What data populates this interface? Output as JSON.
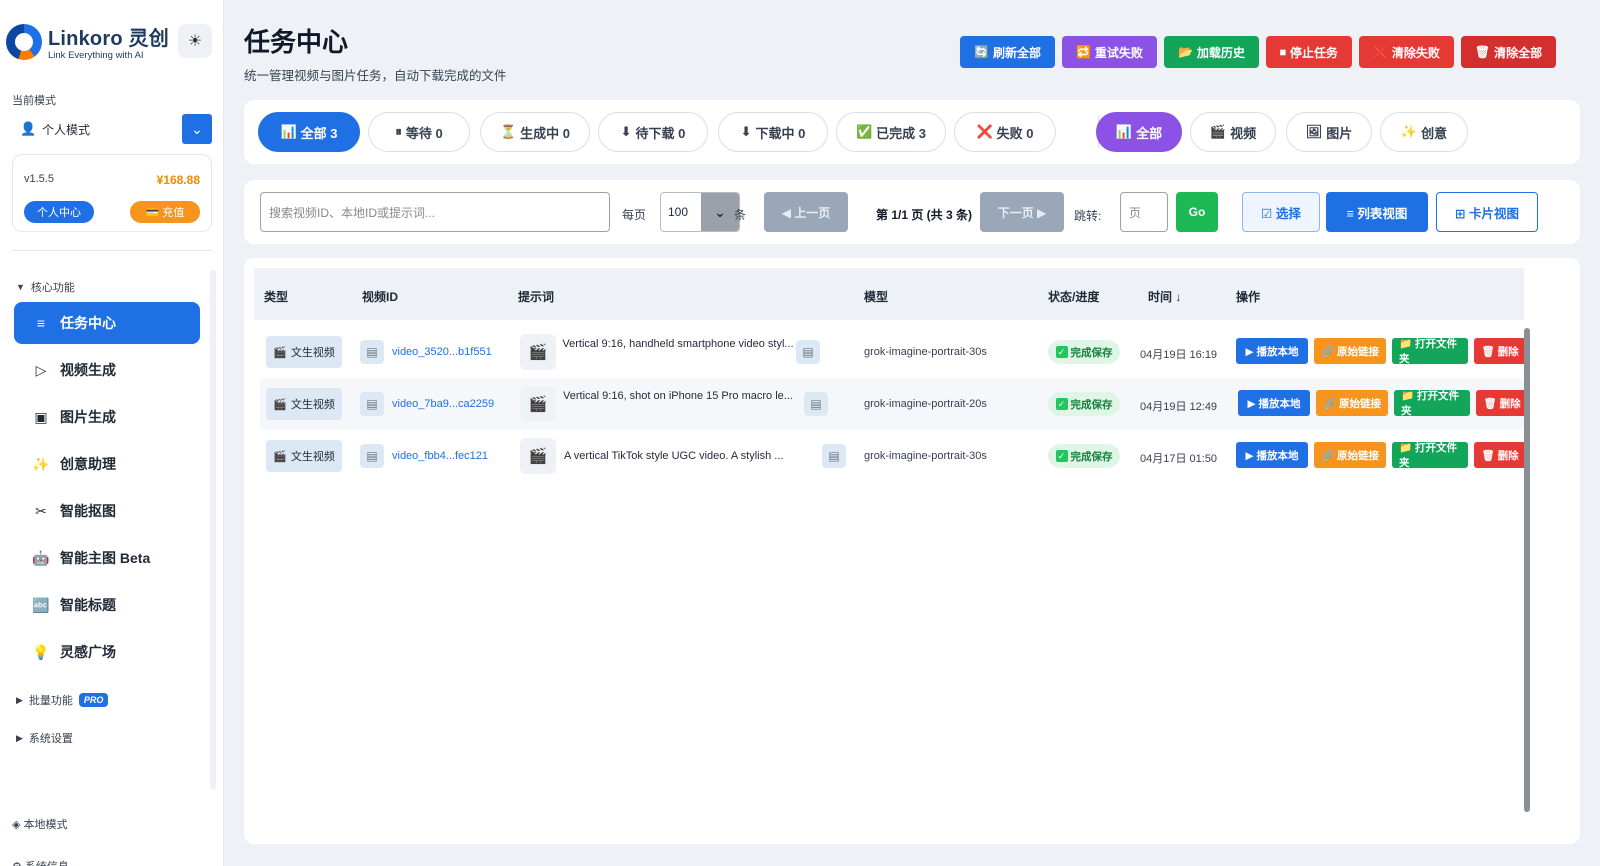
{
  "app": {
    "name": "Linkoro",
    "name_cn": "灵创",
    "tagline": "Link Everything with AI",
    "theme_icon": "☀"
  },
  "sidebar": {
    "mode_label": "当前模式",
    "mode_value": "个人模式",
    "version": "v1.5.5",
    "balance": "¥168.88",
    "center_btn": "个人中心",
    "charge_btn": "充值",
    "group_core": "核心功能",
    "items": [
      {
        "icon": "≡",
        "label": "任务中心",
        "active": true
      },
      {
        "icon": "▷",
        "label": "视频生成"
      },
      {
        "icon": "▣",
        "label": "图片生成"
      },
      {
        "icon": "✨",
        "label": "创意助理"
      },
      {
        "icon": "✂",
        "label": "智能抠图"
      },
      {
        "icon": "🤖",
        "label": "智能主图 Beta"
      },
      {
        "icon": "🔤",
        "label": "智能标题"
      },
      {
        "icon": "💡",
        "label": "灵感广场"
      }
    ],
    "group_batch": "批量功能",
    "pro_badge": "PRO",
    "group_settings": "系统设置",
    "bottom_mode": "◈ 本地模式",
    "bottom_more": "⚙ 系统信息"
  },
  "header": {
    "title": "任务中心",
    "subtitle": "统一管理视频与图片任务，自动下载完成的文件",
    "actions": [
      {
        "icon": "🔄",
        "label": "刷新全部",
        "color": "#1f6fe5"
      },
      {
        "icon": "🔁",
        "label": "重试失败",
        "color": "#8c52e6"
      },
      {
        "icon": "📂",
        "label": "加载历史",
        "color": "#13a55a"
      },
      {
        "icon": "⏹",
        "label": "停止任务",
        "color": "#e53935"
      },
      {
        "icon": "❌",
        "label": "清除失败",
        "color": "#e53935"
      },
      {
        "icon": "🗑",
        "label": "清除全部",
        "color": "#d32f2f"
      }
    ]
  },
  "filters": {
    "status": [
      {
        "icon": "📊",
        "label": "全部 3"
      },
      {
        "icon": "⏸",
        "label": "等待 0"
      },
      {
        "icon": "⏳",
        "label": "生成中 0"
      },
      {
        "icon": "⬇",
        "label": "待下载 0"
      },
      {
        "icon": "⬇",
        "label": "下载中 0"
      },
      {
        "icon": "✅",
        "label": "已完成 3"
      },
      {
        "icon": "❌",
        "label": "失败 0"
      }
    ],
    "type": [
      {
        "icon": "📊",
        "label": "全部"
      },
      {
        "icon": "🎬",
        "label": "视频"
      },
      {
        "icon": "🖼",
        "label": "图片"
      },
      {
        "icon": "✨",
        "label": "创意"
      }
    ]
  },
  "toolbar": {
    "search_placeholder": "搜索视频ID、本地ID或提示词...",
    "per_page_label": "每页",
    "per_page_value": "100",
    "per_page_unit": "条",
    "prev": "◀ 上一页",
    "page_info": "第 1/1 页 (共 3 条)",
    "next": "下一页 ▶",
    "jump_label": "跳转:",
    "jump_placeholder": "页",
    "go": "Go",
    "select": "☑ 选择",
    "list_view": "≡ 列表视图",
    "card_view": "⊞ 卡片视图"
  },
  "table": {
    "headers": [
      "类型",
      "视频ID",
      "提示词",
      "模型",
      "状态/进度",
      "时间 ↓",
      "操作"
    ],
    "rows": [
      {
        "type": "文生视频",
        "id": "video_3520...b1f551",
        "prompt": "Vertical 9:16, handheld smartphone video styl...",
        "model": "grok-imagine-portrait-30s",
        "status": "完成保存",
        "time": "04月19日 16:19"
      },
      {
        "type": "文生视频",
        "id": "video_7ba9...ca2259",
        "prompt": "Vertical 9:16, shot on iPhone 15 Pro macro le...",
        "model": "grok-imagine-portrait-20s",
        "status": "完成保存",
        "time": "04月19日 12:49"
      },
      {
        "type": "文生视频",
        "id": "video_fbb4...fec121",
        "prompt": "A vertical TikTok style UGC video. A stylish ...",
        "model": "grok-imagine-portrait-30s",
        "status": "完成保存",
        "time": "04月17日 01:50"
      }
    ],
    "row_actions": {
      "play": "▶ 播放本地",
      "link": "🔗 原始链接",
      "folder": "📁 打开文件夹",
      "delete": "🗑 删除"
    }
  }
}
